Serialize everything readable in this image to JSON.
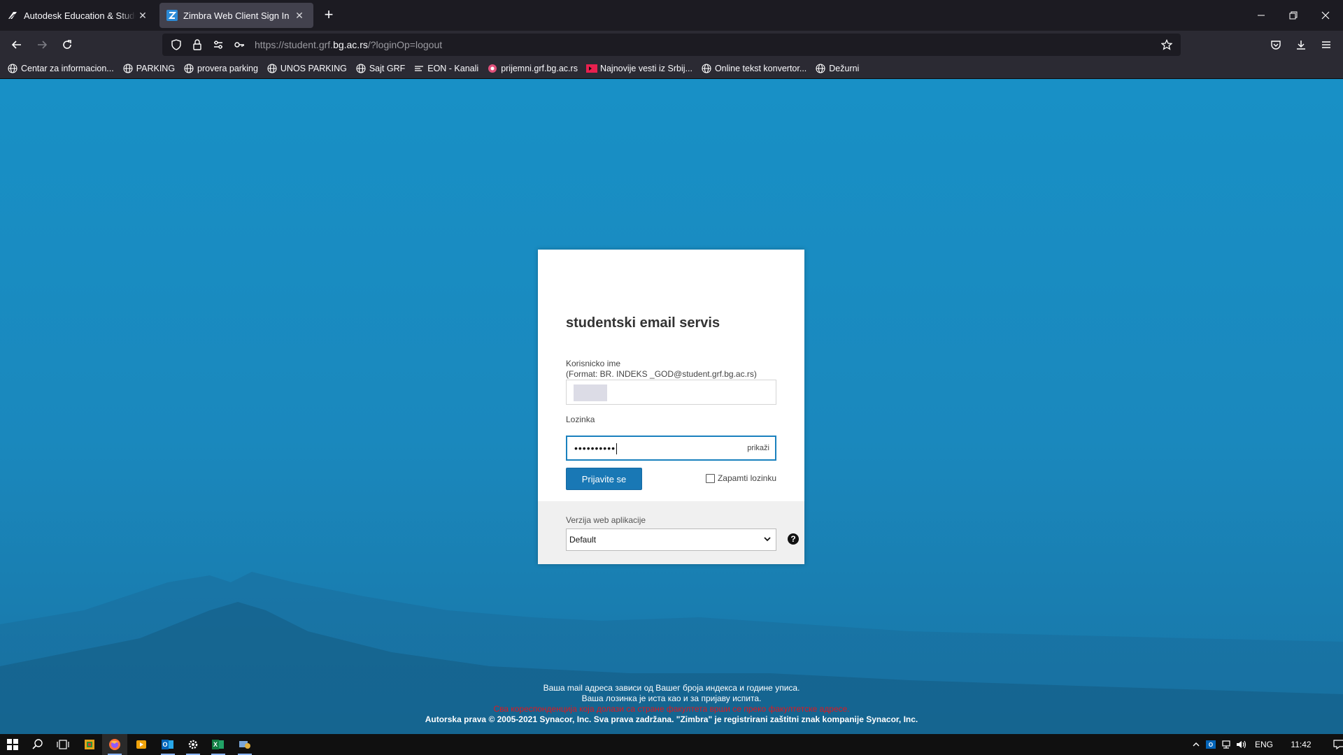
{
  "browser": {
    "tabs": [
      {
        "title": "Autodesk Education & Student A",
        "favicon": "autodesk-icon",
        "active": false
      },
      {
        "title": "Zimbra Web Client Sign In",
        "favicon": "zimbra-icon",
        "active": true
      }
    ],
    "url_host_prefix": "https://student.grf.",
    "url_host_main": "bg.ac.rs",
    "url_path": "/?loginOp=logout",
    "bookmarks": [
      {
        "label": "Centar za informacion...",
        "icon": "globe-icon"
      },
      {
        "label": "PARKING",
        "icon": "globe-icon"
      },
      {
        "label": "provera parking",
        "icon": "globe-icon"
      },
      {
        "label": "UNOS PARKING",
        "icon": "globe-icon"
      },
      {
        "label": "Sajt GRF",
        "icon": "globe-icon"
      },
      {
        "label": "EON - Kanali",
        "icon": "list-icon"
      },
      {
        "label": "prijemni.grf.bg.ac.rs",
        "icon": "pink-circle-icon"
      },
      {
        "label": "Najnovije vesti iz Srbij...",
        "icon": "news-icon"
      },
      {
        "label": "Online tekst konvertor...",
        "icon": "globe-icon"
      },
      {
        "label": "Dežurni",
        "icon": "globe-icon"
      }
    ]
  },
  "login": {
    "title": "studentski email servis",
    "username_label": "Korisnicko ime",
    "username_hint": "(Format: BR. INDEKS _GOD@student.grf.bg.ac.rs)",
    "password_label": "Lozinka",
    "password_value": "••••••••••",
    "show_password": "prikaži",
    "submit": "Prijavite se",
    "remember_me": "Zapamti lozinku",
    "version_label": "Verzija web aplikacije",
    "version_selected": "Default",
    "help": "?"
  },
  "footer": {
    "line1": "Ваша mail адреса зависи од Вашег броја индекса и године уписа.",
    "line2": "Ваша лозинка је иста као и за пријаву испита.",
    "line3": "Сва кореспонденција која долази са стране факултета врши се преко факултетске адресе.",
    "line4": "Autorska prava © 2005-2021 Synacor, Inc. Sva prava zadržana. \"Zimbra\" je registrirani zaštitni znak kompanije Synacor, Inc."
  },
  "taskbar": {
    "language": "ENG",
    "time": "11:42"
  },
  "colors": {
    "accent": "#1978b5",
    "background": "#1890c6",
    "warning": "#e0181e"
  }
}
